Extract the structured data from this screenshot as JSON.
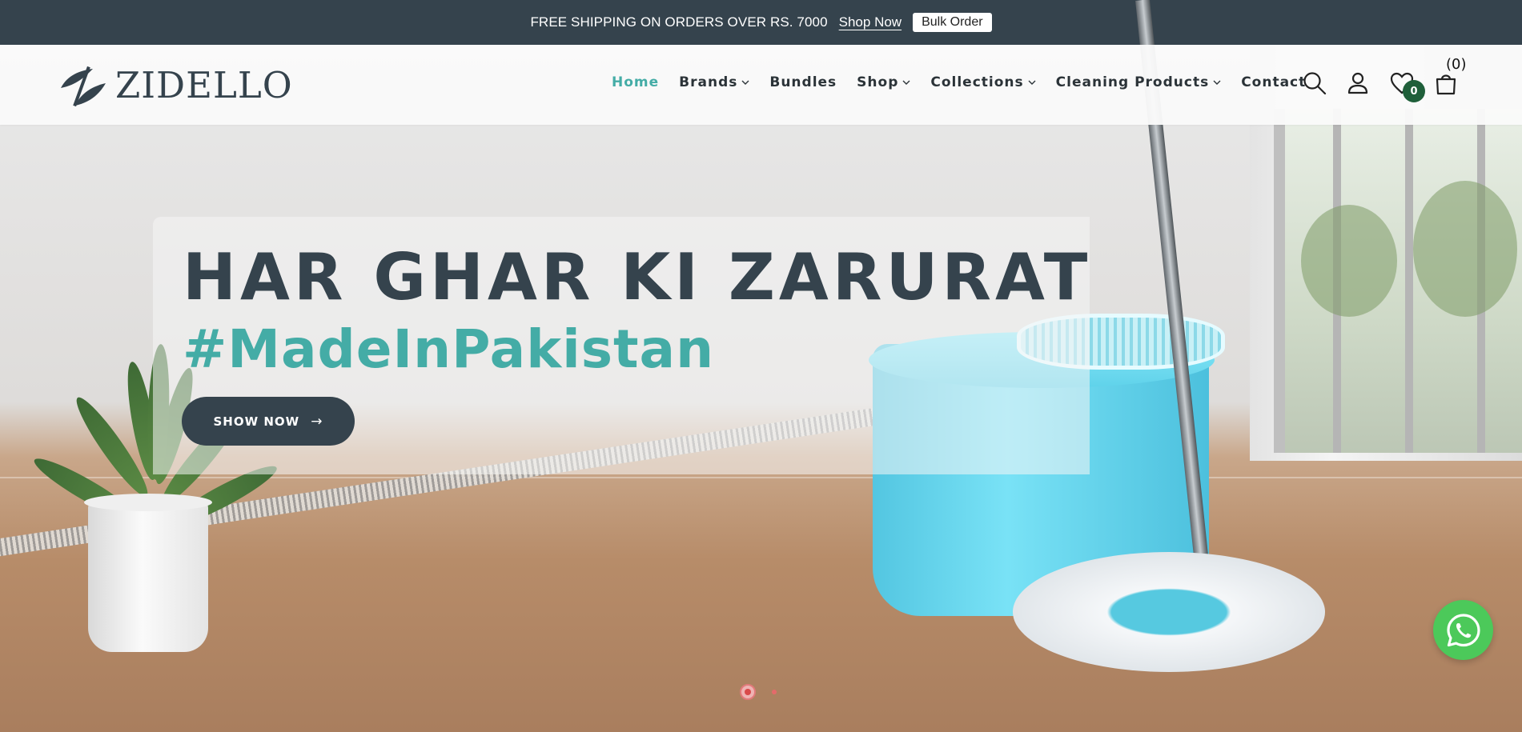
{
  "announcement": {
    "message": "FREE SHIPPING ON ORDERS OVER RS. 7000",
    "shop_link": "Shop Now",
    "bulk_button": "Bulk Order"
  },
  "brand": {
    "logo_text": "ZIDELLO"
  },
  "nav": {
    "items": [
      {
        "label": "Home",
        "active": true,
        "dropdown": false
      },
      {
        "label": "Brands",
        "active": false,
        "dropdown": true
      },
      {
        "label": "Bundles",
        "active": false,
        "dropdown": false
      },
      {
        "label": "Shop",
        "active": false,
        "dropdown": true
      },
      {
        "label": "Collections",
        "active": false,
        "dropdown": true
      },
      {
        "label": "Cleaning Products",
        "active": false,
        "dropdown": true
      },
      {
        "label": "Contact",
        "active": false,
        "dropdown": false
      }
    ]
  },
  "header_icons": {
    "search": "search-icon",
    "account": "user-icon",
    "wishlist": "heart-icon",
    "wishlist_count": "0",
    "cart": "shopping-bag-icon",
    "cart_count": "(0)"
  },
  "hero": {
    "headline": "HAR GHAR KI ZARURAT",
    "hashtag": "#MadeInPakistan",
    "cta_label": "SHOW NOW",
    "cta_arrow": "→",
    "slides_total": 2,
    "active_slide": 1
  },
  "colors": {
    "dark_slate": "#35434d",
    "accent_teal": "#44aca6",
    "whatsapp_green": "#4cc95a",
    "badge_green": "#1f5f3a",
    "dot_red": "#d94a4a"
  },
  "floating": {
    "whatsapp": "whatsapp-icon"
  }
}
